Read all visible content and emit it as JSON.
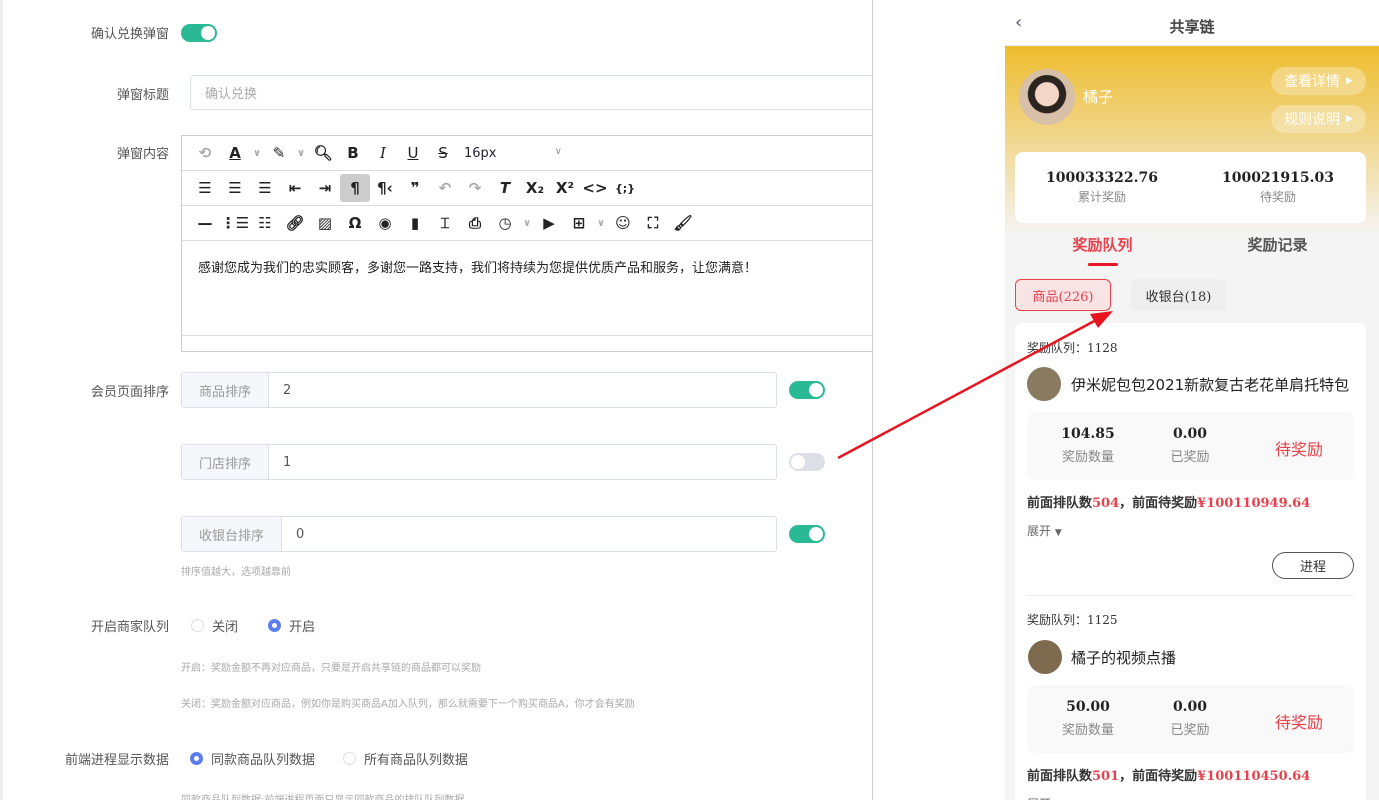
{
  "form": {
    "confirm_popup_label": "确认兑换弹窗",
    "popup_title_label": "弹窗标题",
    "popup_title_placeholder": "确认兑换",
    "popup_content_label": "弹窗内容",
    "font_size": "16px",
    "popup_content_text": "感谢您成为我们的忠实顾客，多谢您一路支持，我们将持续为您提供优质产品和服务，让您满意！",
    "member_sort_label": "会员页面排序",
    "sort_rows": [
      {
        "addon": "商品排序",
        "value": "2",
        "enabled": true
      },
      {
        "addon": "门店排序",
        "value": "1",
        "enabled": false
      },
      {
        "addon": "收银台排序",
        "value": "0",
        "enabled": true
      }
    ],
    "sort_hint": "排序值越大，选项越靠前",
    "merchant_queue_label": "开启商家队列",
    "merchant_queue_options": [
      "关闭",
      "开启"
    ],
    "merchant_queue_selected": "开启",
    "merchant_hint_on": "开启：奖励金额不再对应商品，只要是开启共享链的商品都可以奖励",
    "merchant_hint_off": "关闭：奖励金额对应商品，例如你是购买商品A加入队列，那么就需要下一个购买商品A，你才会有奖励",
    "frontend_data_label": "前端进程显示数据",
    "frontend_data_options": [
      "同款商品队列数据",
      "所有商品队列数据"
    ],
    "frontend_data_selected": "同款商品队列数据",
    "frontend_hint": "同款商品队列数据:前端进程页面只显示同款商品的排队队列数据"
  },
  "phone": {
    "title": "共享链",
    "user_name": "橘子",
    "view_details": "查看详情",
    "rules": "规则说明",
    "total_reward": "100033322.76",
    "total_reward_label": "累计奖励",
    "pending_reward": "100021915.03",
    "pending_reward_label": "待奖励",
    "tabs": [
      "奖励队列",
      "奖励记录"
    ],
    "chips": [
      "商品(226)",
      "收银台(18)"
    ],
    "queue_items": [
      {
        "queue_label": "奖励队列：",
        "queue_no": "1128",
        "product": "伊米妮包包2021新款复古老花单肩托特包",
        "reward_amount": "104.85",
        "reward_amount_label": "奖励数量",
        "rewarded": "0.00",
        "rewarded_label": "已奖励",
        "status": "待奖励",
        "ahead_prefix": "前面排队数",
        "ahead_count": "504",
        "ahead_mid": "，前面待奖励",
        "ahead_amount": "¥100110949.64",
        "expand": "展开",
        "progress_btn": "进程"
      },
      {
        "queue_label": "奖励队列：",
        "queue_no": "1125",
        "product": "橘子的视频点播",
        "reward_amount": "50.00",
        "reward_amount_label": "奖励数量",
        "rewarded": "0.00",
        "rewarded_label": "已奖励",
        "status": "待奖励",
        "ahead_prefix": "前面排队数",
        "ahead_count": "501",
        "ahead_mid": "，前面待奖励",
        "ahead_amount": "¥100110450.64",
        "expand": "展开"
      }
    ]
  },
  "colors": {
    "accent_red": "#e8414b",
    "toggle_green": "#2bb894",
    "radio_blue": "#5b7ff0",
    "header_yellow": "#eebc2d"
  }
}
